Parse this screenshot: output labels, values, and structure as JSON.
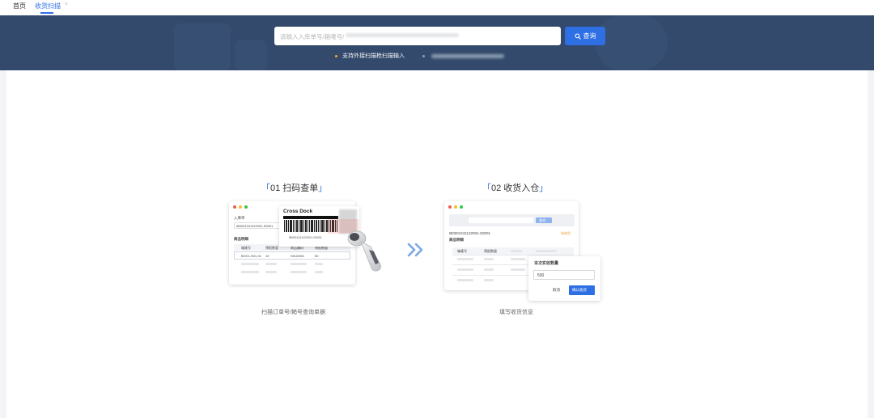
{
  "nav": {
    "tabs": [
      {
        "label": "首页"
      },
      {
        "label": "收货扫描"
      }
    ]
  },
  "search": {
    "placeholder": "请输入入库单号/箱唛号/",
    "button_label": "查询",
    "hint": "支持外接扫描枪扫描输入"
  },
  "steps": [
    {
      "title": "01 扫码查单",
      "caption": "扫描订单号/箱号查询单据",
      "card": {
        "field_label": "入库单",
        "field_value": "IB0001241122001-S0001",
        "section_label": "商品明细",
        "columns": [
          "箱唛号",
          "预报数量",
          "商品编码",
          "预报数量"
        ],
        "row": [
          "BOX1-S01-01",
          "10",
          "SKU0001",
          "50"
        ],
        "label_title": "Cross Dock",
        "label_code": "IB0001241122001-S0001"
      }
    },
    {
      "title": "02 收货入仓",
      "caption": "填写收货信息",
      "card": {
        "search_button": "查询",
        "order_no": "IB0001241122001-S0001",
        "status": "待收货",
        "section_label": "商品明细",
        "columns": [
          "箱唛号",
          "预报数量"
        ],
        "popup_title": "本次实收数量",
        "popup_value": "500",
        "popup_cancel": "取消",
        "popup_confirm": "确认收货"
      }
    }
  ],
  "colors": {
    "primary": "#2f6fe4",
    "banner": "#334a6c",
    "hint_dot": "#f5a623"
  }
}
